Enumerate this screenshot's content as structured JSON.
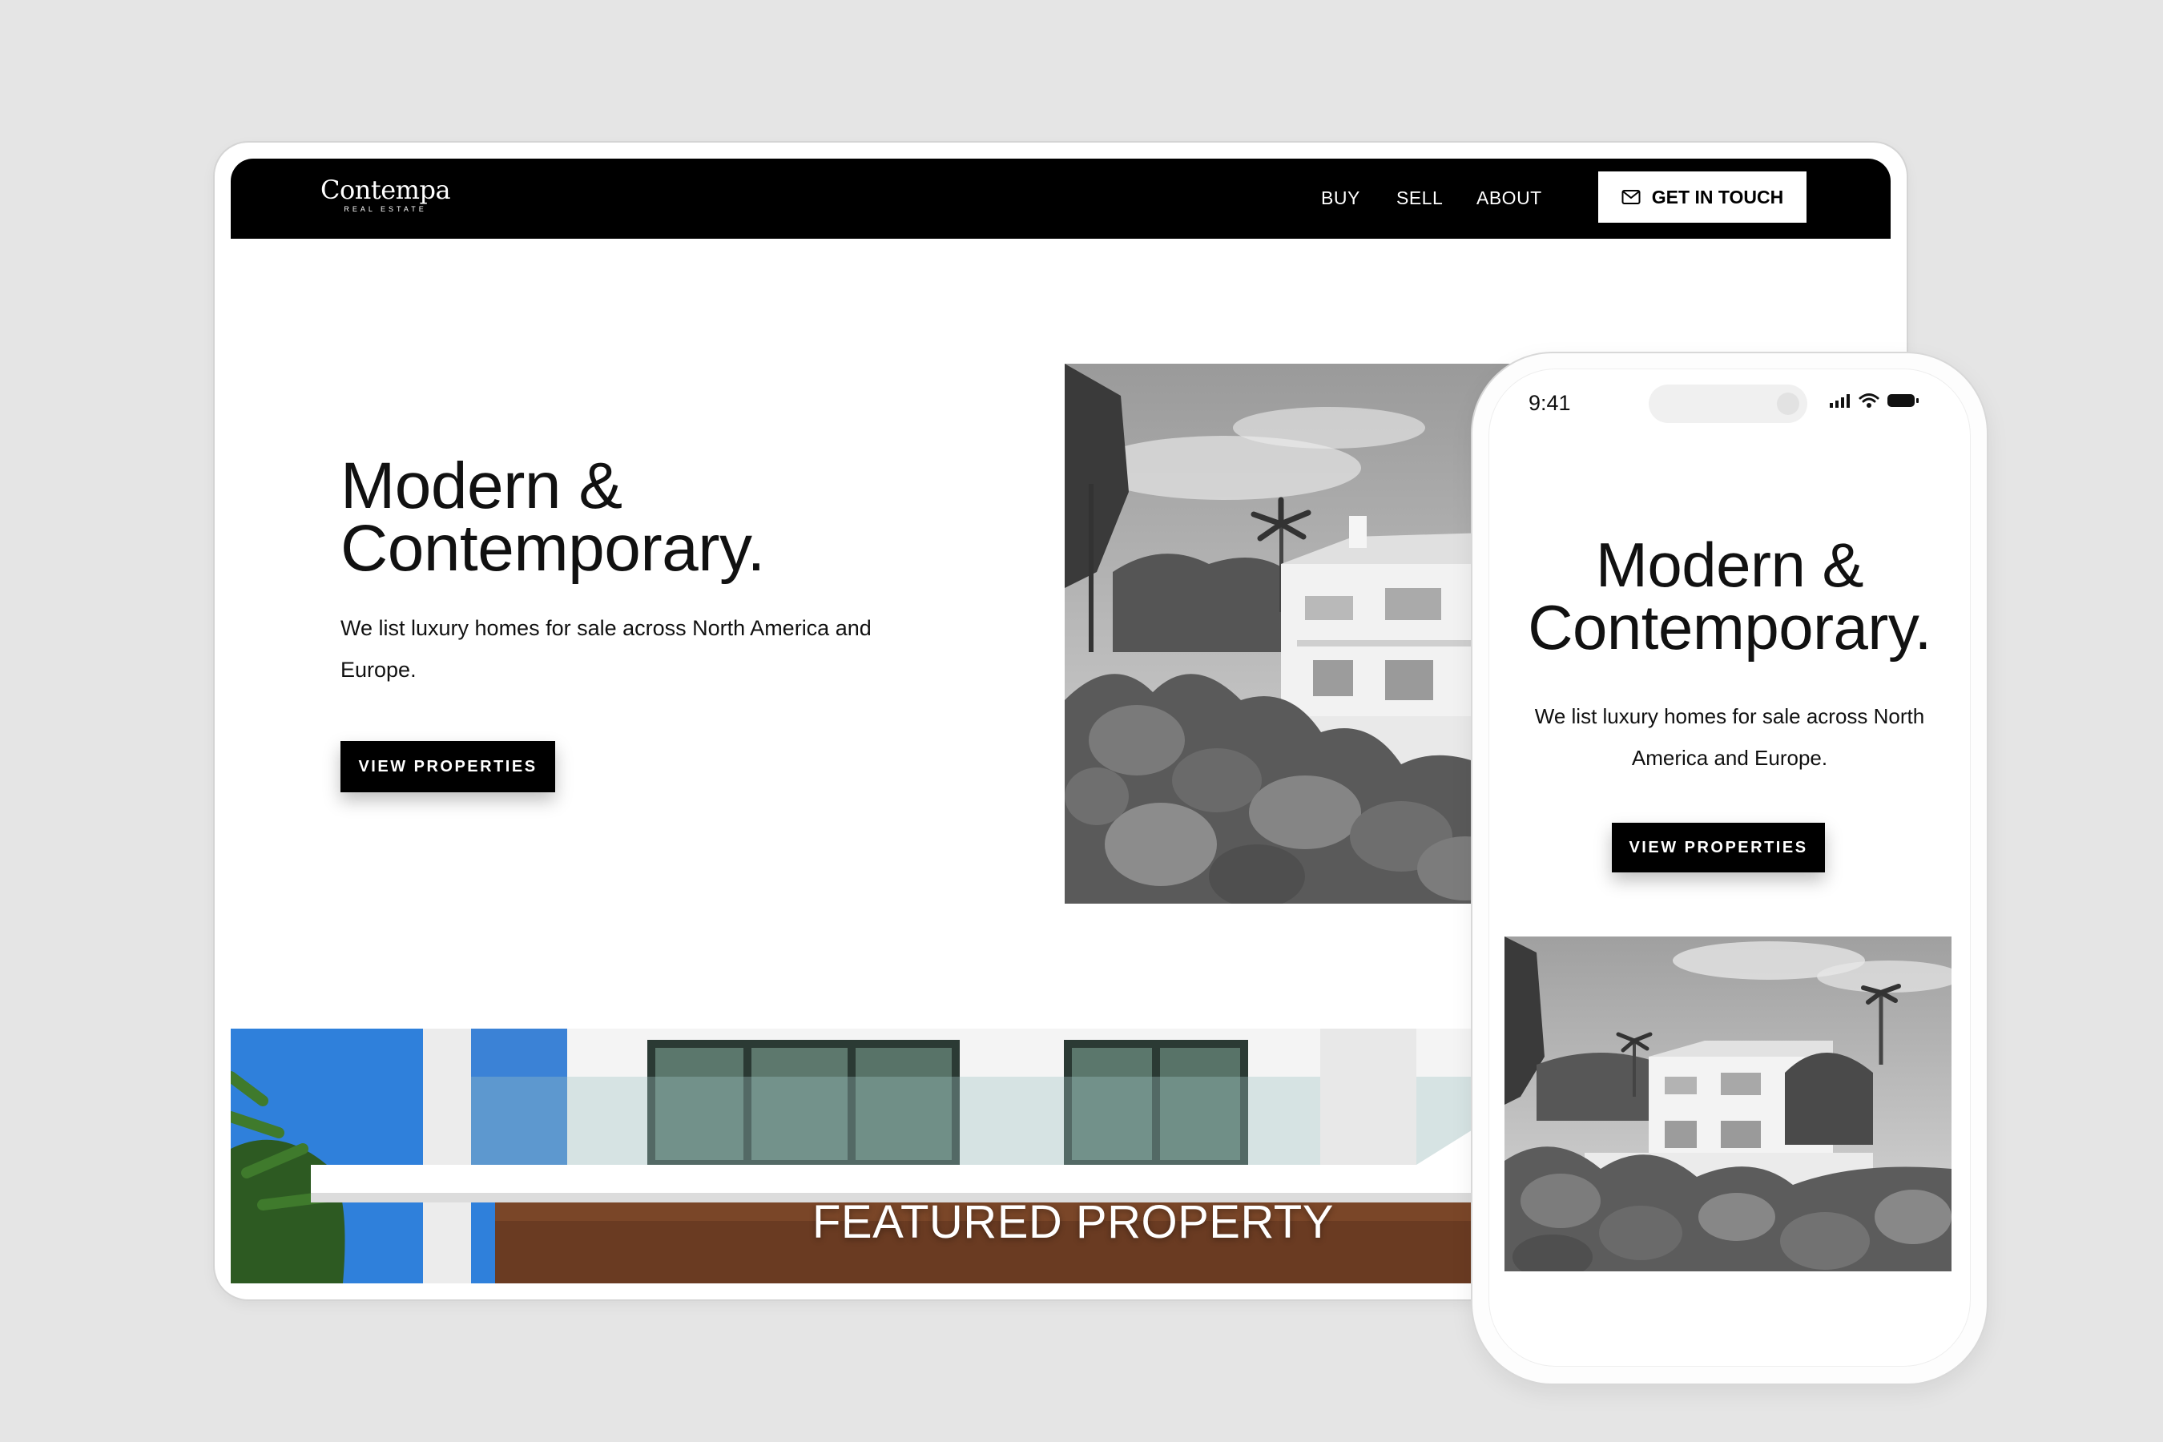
{
  "desktop": {
    "nav": {
      "logo": "Contempa",
      "logo_sub": "REAL ESTATE",
      "links": [
        "BUY",
        "SELL",
        "ABOUT"
      ],
      "cta_label": "GET IN TOUCH",
      "cta_icon": "mail-icon"
    },
    "hero": {
      "title_line1": "Modern &",
      "title_line2": "Contemporary.",
      "subtitle": "We list luxury homes for sale across North America and Europe.",
      "button_label": "VIEW PROPERTIES"
    },
    "featured": {
      "title": "FEATURED PROPERTY"
    }
  },
  "phone": {
    "status": {
      "time": "9:41",
      "icons": [
        "signal-icon",
        "wifi-icon",
        "battery-icon"
      ]
    },
    "hero": {
      "title_line1": "Modern &",
      "title_line2": "Contemporary.",
      "subtitle": "We list luxury homes for sale across North America and Europe.",
      "button_label": "VIEW PROPERTIES"
    }
  },
  "colors": {
    "background": "#e5e5e5",
    "nav": "#000000",
    "accent": "#000000",
    "sky": "#2f7fd9"
  }
}
